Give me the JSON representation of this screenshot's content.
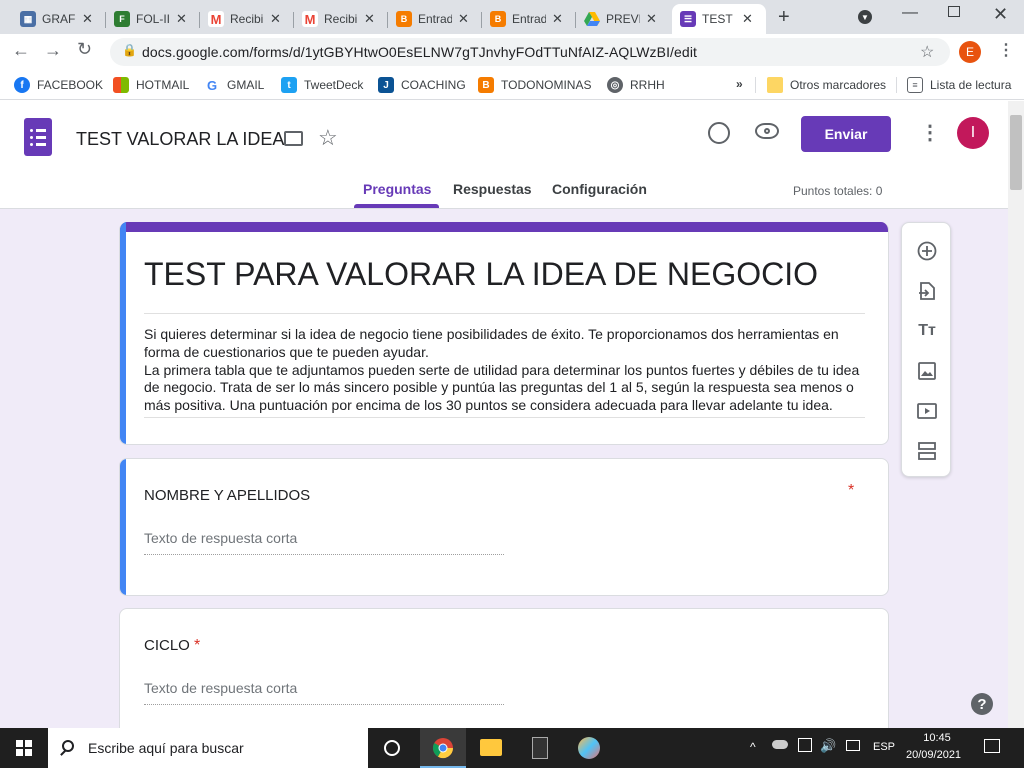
{
  "browser": {
    "tabs": [
      {
        "title": "GRAFO",
        "icon": "grafo-icon",
        "color": "#4a6fa5",
        "active": false
      },
      {
        "title": "FOL-II",
        "icon": "fol-icon",
        "color": "#2e7d32",
        "active": false
      },
      {
        "title": "Recibi",
        "icon": "gmail-icon",
        "color": "#ea4335",
        "active": false
      },
      {
        "title": "Recibi",
        "icon": "gmail-icon",
        "color": "#ea4335",
        "active": false
      },
      {
        "title": "Entrad",
        "icon": "blogger-icon",
        "color": "#f57c00",
        "active": false
      },
      {
        "title": "Entrad",
        "icon": "blogger-icon",
        "color": "#f57c00",
        "active": false
      },
      {
        "title": "PREVE",
        "icon": "drive-icon",
        "color": "#34a853",
        "active": false
      },
      {
        "title": "TEST",
        "icon": "forms-icon",
        "color": "#673ab7",
        "active": true
      }
    ],
    "url": "docs.google.com/forms/d/1ytGBYHtwO0EsELNW7gTJnvhyFOdTTuNfAIZ-AQLWzBI/edit",
    "profile_initial": "E",
    "bookmarks": [
      {
        "label": "FACEBOOK",
        "icon": "facebook-icon",
        "color": "#1877f2"
      },
      {
        "label": "HOTMAIL",
        "icon": "microsoft-icon",
        "color": "#f25022"
      },
      {
        "label": "GMAIL",
        "icon": "google-icon",
        "color": "#4285f4"
      },
      {
        "label": "TweetDeck",
        "icon": "tweetdeck-icon",
        "color": "#1da1f2"
      },
      {
        "label": "COACHING",
        "icon": "coaching-icon",
        "color": "#0b5394"
      },
      {
        "label": "TODONOMINAS",
        "icon": "blogger-icon",
        "color": "#f57c00"
      },
      {
        "label": "RRHH",
        "icon": "globe-icon",
        "color": "#5f6368"
      }
    ],
    "other_bookmarks": "Otros marcadores",
    "reading_list": "Lista de lectura"
  },
  "forms_header": {
    "title": "TEST VALORAR LA IDEA",
    "send_label": "Enviar",
    "avatar_initial": "I",
    "tabs": [
      "Preguntas",
      "Respuestas",
      "Configuración"
    ],
    "active_tab": "Preguntas",
    "total_points": "Puntos totales: 0",
    "accent": "#673ab7"
  },
  "form": {
    "title": "TEST PARA VALORAR LA IDEA DE NEGOCIO",
    "description": "Si quieres determinar si la idea de negocio tiene posibilidades de éxito. Te proporcionamos dos herramientas en forma de cuestionarios que te pueden ayudar.\nLa primera tabla que te adjuntamos pueden serte de utilidad para determinar los puntos fuertes y débiles de tu idea de negocio. Trata de ser lo más sincero posible y puntúa las preguntas del 1 al 5, según la respuesta sea menos o más positiva. Una puntuación por encima de los 30 puntos se considera adecuada para llevar adelante tu idea.",
    "questions": [
      {
        "title": "NOMBRE Y APELLIDOS",
        "required_mark": "*",
        "placeholder": "Texto de respuesta corta"
      },
      {
        "title": "CICLO",
        "required_mark": "*",
        "placeholder": "Texto de respuesta corta"
      }
    ]
  },
  "taskbar": {
    "search_placeholder": "Escribe aquí para buscar",
    "language": "ESP",
    "time": "10:45",
    "date": "20/09/2021"
  }
}
